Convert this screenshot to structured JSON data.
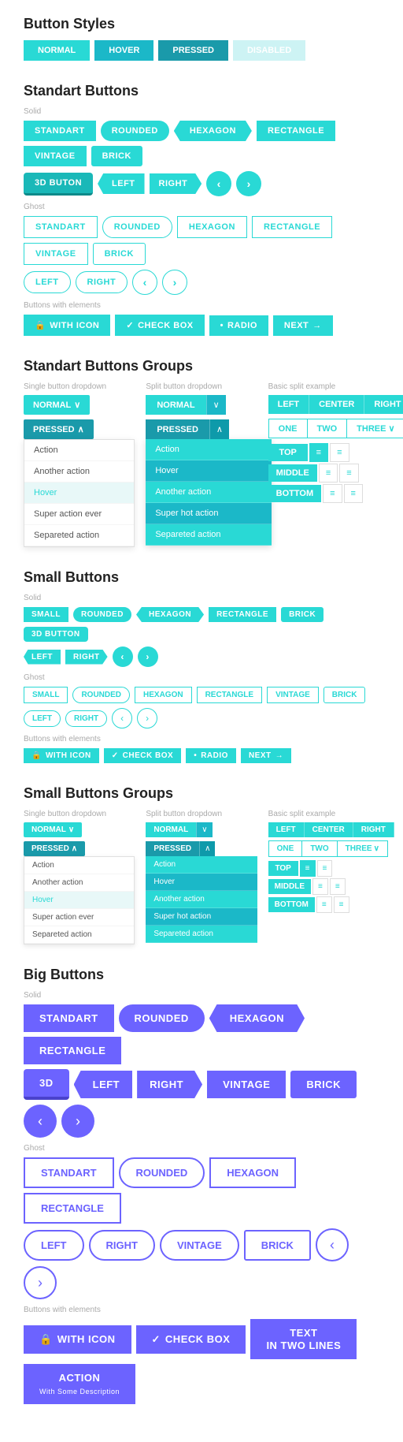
{
  "buttonStyles": {
    "title": "Button Styles",
    "buttons": [
      {
        "label": "NORMAL",
        "style": "normal"
      },
      {
        "label": "HOVER",
        "style": "hover"
      },
      {
        "label": "PRESSED",
        "style": "pressed"
      },
      {
        "label": "DISABLED",
        "style": "disabled"
      }
    ]
  },
  "standartButtons": {
    "title": "Standart Buttons",
    "solid": {
      "label": "Solid",
      "row1": [
        "STANDART",
        "ROUNDED",
        "HEXAGON",
        "RECTANGLE",
        "VINTAGE",
        "BRICK"
      ],
      "row2": [
        "3D BUTON",
        "LEFT",
        "RIGHT",
        "‹",
        "›"
      ]
    },
    "ghost": {
      "label": "Ghost",
      "row1": [
        "STANDART",
        "ROUNDED",
        "HEXAGON",
        "RECTANGLE",
        "VINTAGE",
        "BRICK"
      ],
      "row2": [
        "LEFT",
        "RIGHT",
        "‹",
        "›"
      ]
    },
    "withElements": {
      "label": "Buttons with elements",
      "buttons": [
        "WITH ICON",
        "CHECK BOX",
        "RADIO",
        "NEXT →"
      ]
    }
  },
  "standartButtonsGroups": {
    "title": "Standart Buttons Groups",
    "singleDropdown": {
      "label": "Single button dropdown",
      "normal": "NORMAL ∨",
      "pressed": "PRESSED ∧",
      "items": [
        "Action",
        "Another action",
        "Hover",
        "Super action ever",
        "Separeted action"
      ]
    },
    "splitDropdown": {
      "label": "Split button dropdown",
      "normal": "NORMAL",
      "pressed": "PRESSED",
      "items": [
        "Action",
        "Hover",
        "Another action",
        "Super hot action",
        "Separeted action"
      ]
    },
    "basicSplit": {
      "label": "Basic split example",
      "row1": [
        "LEFT",
        "CENTER",
        "RIGHT"
      ],
      "row2": [
        "ONE",
        "TWO",
        "THREE ∨"
      ],
      "rows3": [
        {
          "main": "TOP",
          "icons": [
            "≡",
            "≡"
          ]
        },
        {
          "main": "MIDDLE",
          "icons": [
            "≡",
            "≡"
          ]
        },
        {
          "main": "BOTTOM",
          "icons": [
            "≡",
            "≡"
          ]
        }
      ]
    }
  },
  "smallButtons": {
    "title": "Small Buttons",
    "solid": {
      "label": "Solid",
      "row1": [
        "SMALL",
        "ROUNDED",
        "HEXAGON",
        "RECTANGLE",
        "BRICK",
        "3D BUTTON"
      ],
      "row2": [
        "LEFT",
        "RIGHT",
        "‹",
        "›"
      ]
    },
    "ghost": {
      "label": "Ghost",
      "row1": [
        "SMALL",
        "ROUNDED",
        "HEXAGON",
        "RECTANGLE",
        "VINTAGE",
        "BRICK"
      ],
      "row2": [
        "LEFT",
        "RIGHT",
        "‹",
        "›"
      ]
    },
    "withElements": {
      "label": "Buttons with elements",
      "buttons": [
        "WITH ICON",
        "CHECK BOX",
        "RADIO",
        "NEXT →"
      ]
    }
  },
  "smallButtonsGroups": {
    "title": "Small Buttons Groups",
    "singleDropdown": {
      "label": "Single button dropdown",
      "normal": "NORMAL ∨",
      "pressed": "PRESSED ∧",
      "items": [
        "Action",
        "Another action",
        "Hover",
        "Super action ever",
        "Separeted action"
      ]
    },
    "splitDropdown": {
      "label": "Split button dropdown",
      "normal": "NORMAL",
      "pressed": "PRESSED",
      "items": [
        "Action",
        "Hover",
        "Another action",
        "Super hot action",
        "Separeted action"
      ]
    },
    "basicSplit": {
      "label": "Basic split example",
      "row1": [
        "LEFT",
        "CENTER",
        "RIGHT"
      ],
      "row2": [
        "ONE",
        "TWO",
        "THREE ∨"
      ],
      "rows3": [
        {
          "main": "TOP",
          "icons": [
            "≡",
            "≡"
          ]
        },
        {
          "main": "MIDDLE",
          "icons": [
            "≡",
            "≡"
          ]
        },
        {
          "main": "BOTTOM",
          "icons": [
            "≡",
            "≡"
          ]
        }
      ]
    }
  },
  "bigButtons": {
    "title": "Big Buttons",
    "solid": {
      "label": "Solid",
      "row1": [
        "STANDART",
        "ROUNDED",
        "HEXAGON",
        "RECTANGLE"
      ],
      "row2": [
        "3D",
        "LEFT",
        "RIGHT",
        "VINTAGE",
        "BRICK",
        "‹",
        "›"
      ]
    },
    "ghost": {
      "label": "Ghost",
      "row1": [
        "STANDART",
        "ROUNDED",
        "HEXAGON",
        "RECTANGLE"
      ],
      "row2": [
        "LEFT",
        "RIGHT",
        "VINTAGE",
        "BRICK",
        "‹",
        "›"
      ]
    },
    "withElements": {
      "label": "Buttons with elements",
      "buttons": [
        "WITH ICON",
        "CHECK BOX",
        "TEXT IN TWO LINES",
        "ACTION"
      ]
    }
  },
  "icons": {
    "lock": "🔒",
    "check": "✓",
    "dot": "•",
    "chevronDown": "∨",
    "chevronUp": "∧",
    "chevronLeft": "‹",
    "chevronRight": "›",
    "arrow": "→",
    "align": "≡"
  }
}
